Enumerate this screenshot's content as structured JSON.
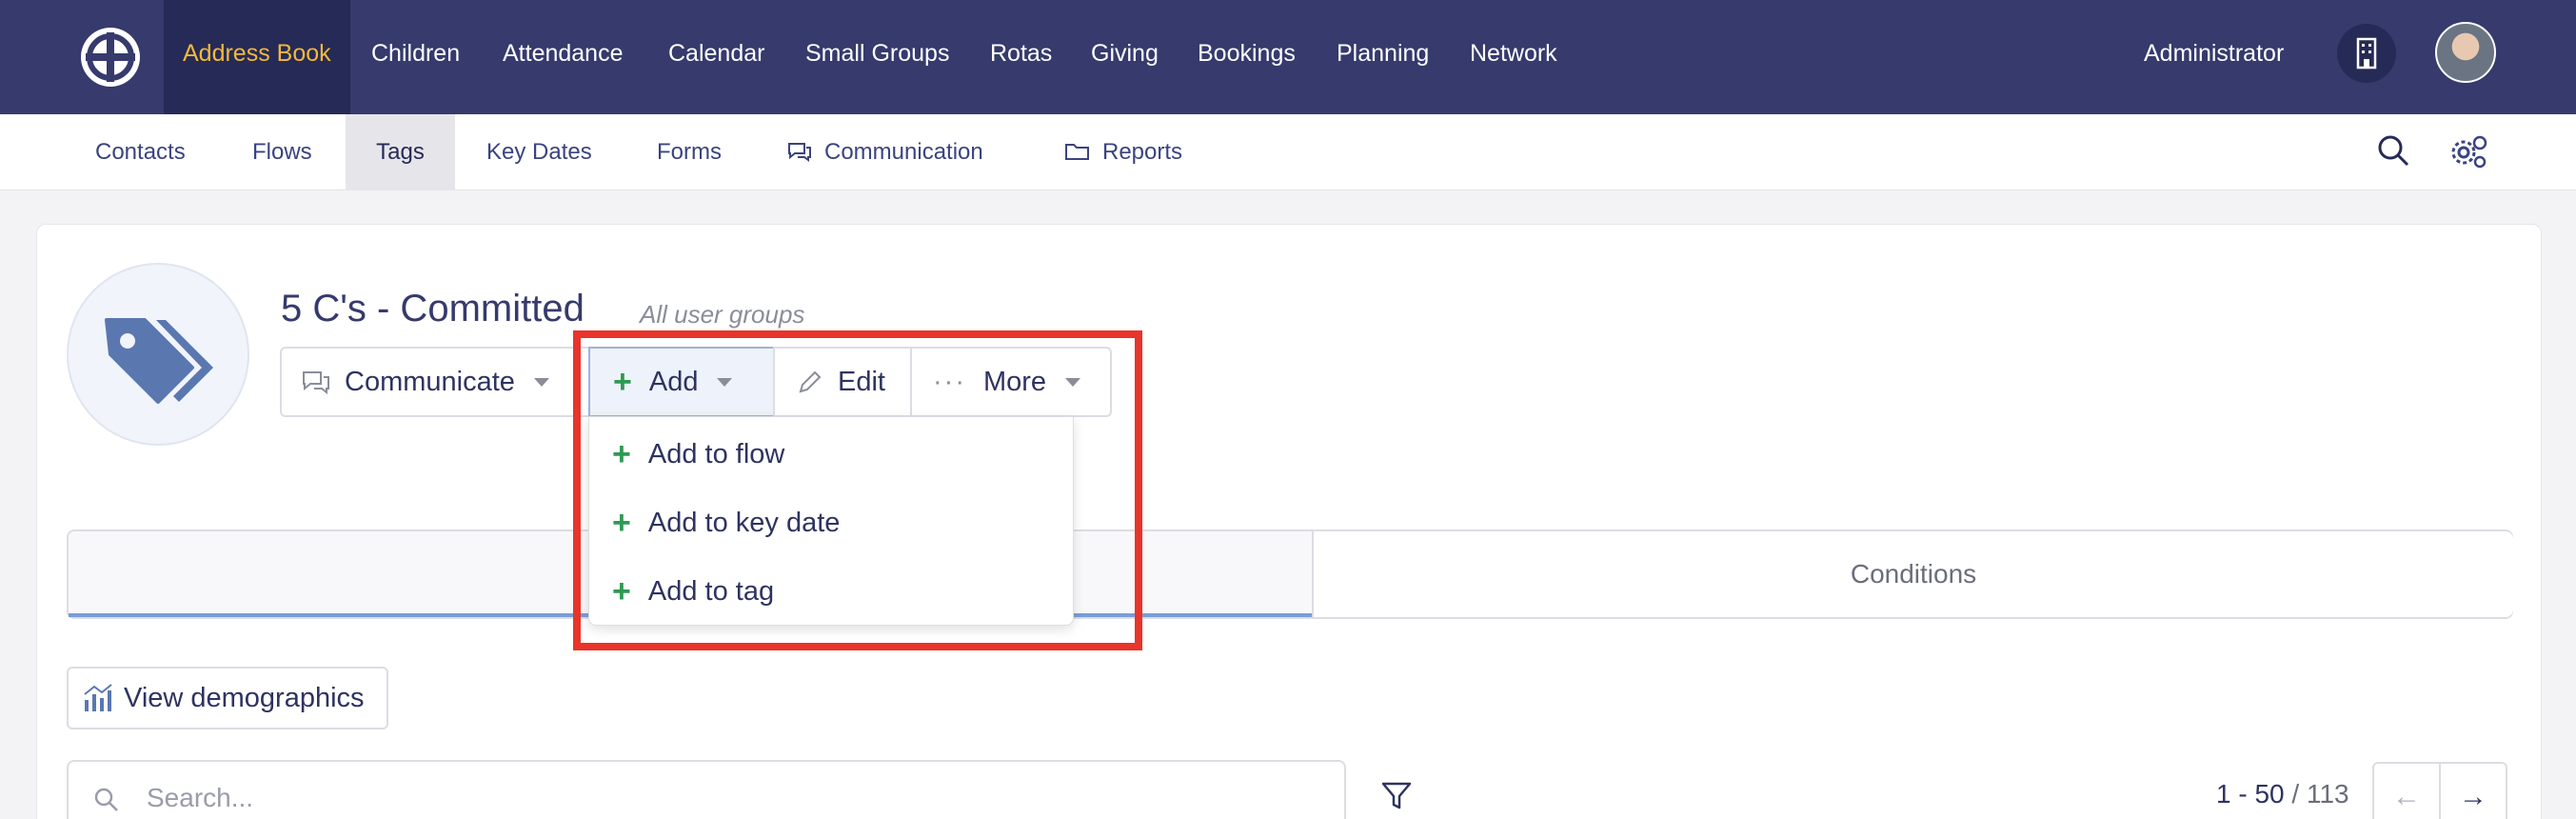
{
  "nav": {
    "items": [
      "Address Book",
      "Children",
      "Attendance",
      "Calendar",
      "Small Groups",
      "Rotas",
      "Giving",
      "Bookings",
      "Planning",
      "Network"
    ],
    "user": "Administrator"
  },
  "subnav": {
    "items": [
      "Contacts",
      "Flows",
      "Tags",
      "Key Dates",
      "Forms",
      "Communication",
      "Reports"
    ]
  },
  "tag": {
    "title": "5 C's - Committed",
    "scope": "All user groups"
  },
  "actions": {
    "communicate": "Communicate",
    "add": "Add",
    "edit": "Edit",
    "more": "More"
  },
  "add_menu": [
    "Add to flow",
    "Add to key date",
    "Add to tag"
  ],
  "tabs": {
    "conditions": "Conditions"
  },
  "demographics_label": "View demographics",
  "search": {
    "placeholder": "Search..."
  },
  "paging": {
    "range": "1 - 50",
    "total": "/ 113"
  },
  "colors": {
    "nav_bg": "#363a6c",
    "active_nav": "#f2b93a",
    "highlight": "#e8342a",
    "plus": "#2e9a52"
  }
}
